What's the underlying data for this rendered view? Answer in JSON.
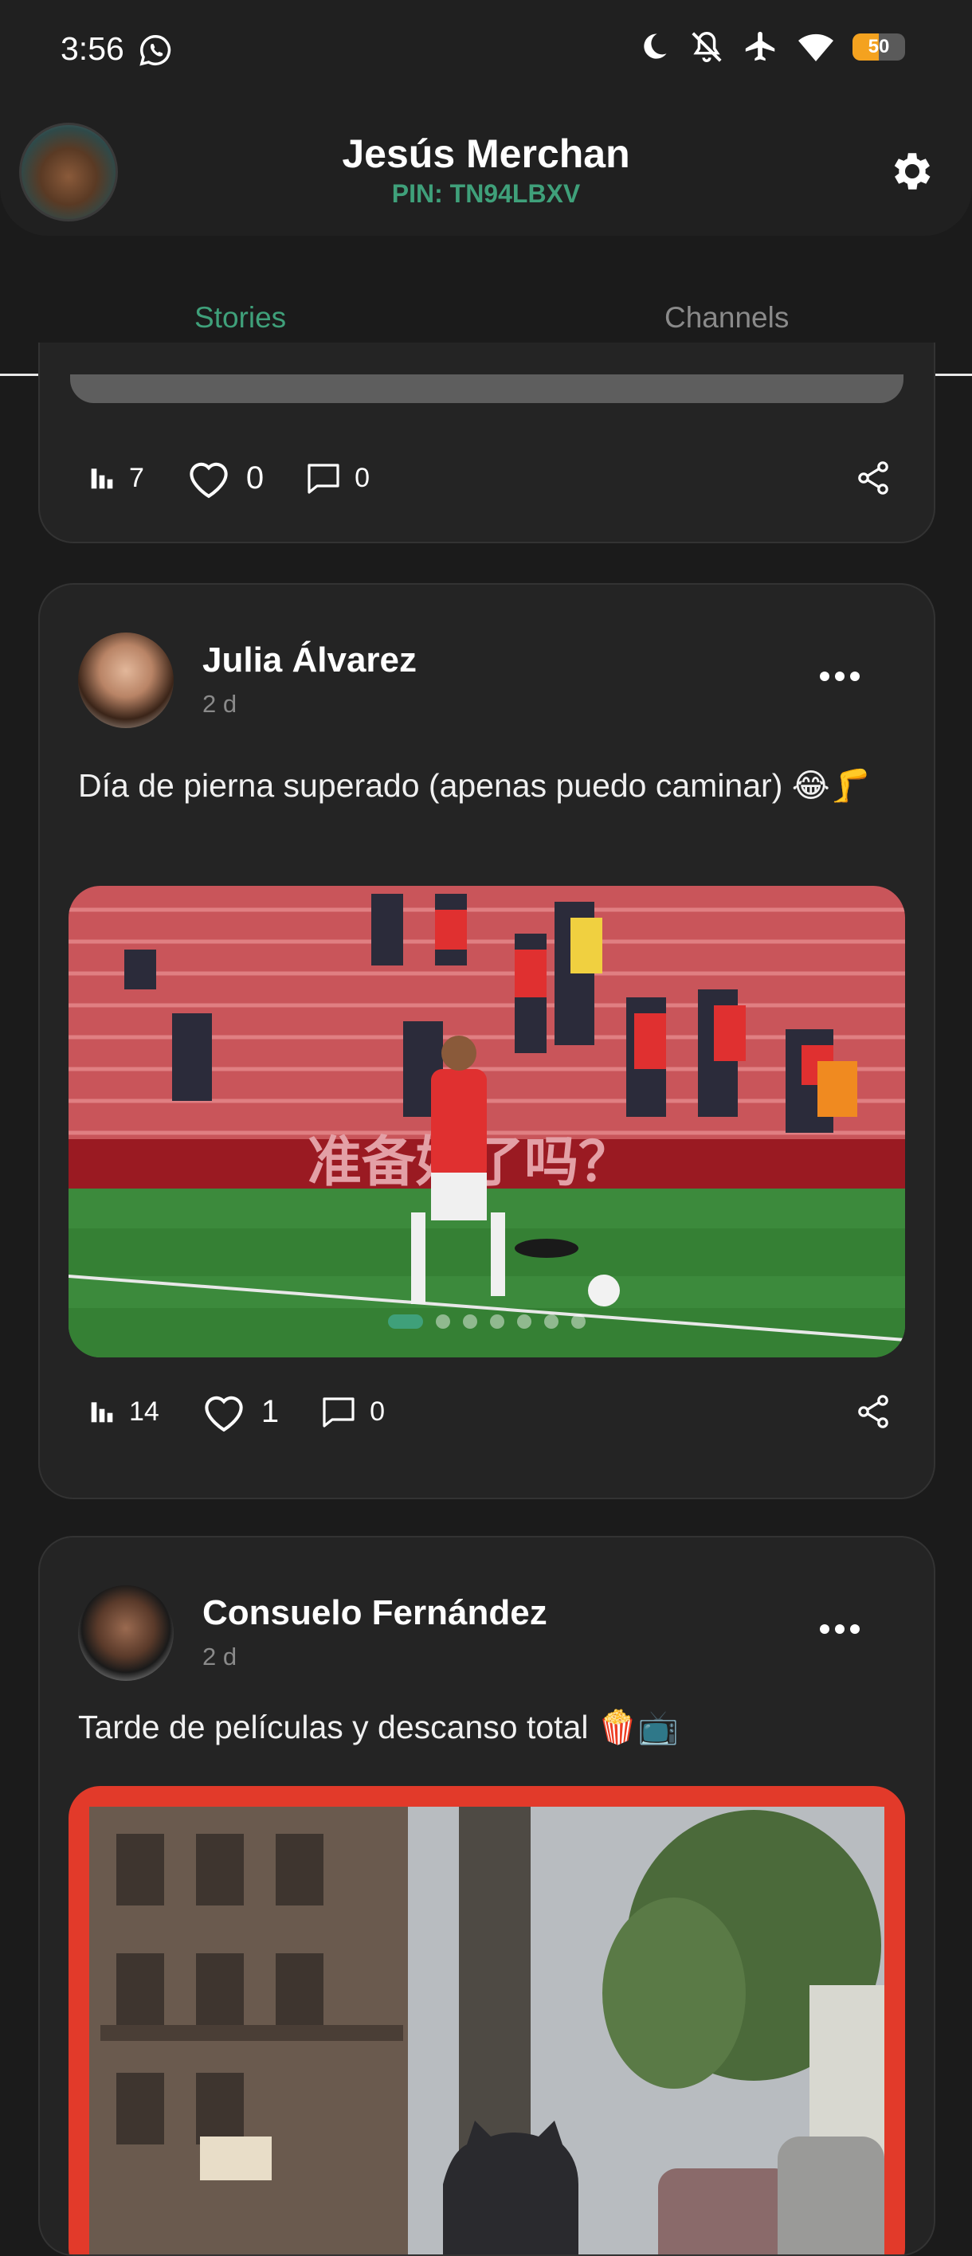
{
  "status_bar": {
    "time": "3:56",
    "battery_level": "50",
    "icons": [
      "whatsapp-icon",
      "moon-icon",
      "bell-off-icon",
      "airplane-icon",
      "wifi-icon",
      "battery-icon"
    ]
  },
  "header": {
    "name": "Jesús Merchan",
    "pin": "PIN: TN94LBXV"
  },
  "tabs": [
    {
      "label": "Stories",
      "selected": true
    },
    {
      "label": "Channels",
      "selected": false
    }
  ],
  "colors": {
    "accent": "#3fa07a",
    "background": "#1b1b1b",
    "card": "#242424",
    "battery": "#f4a21f"
  },
  "posts": [
    {
      "views": "7",
      "likes": "0",
      "comments": "0"
    },
    {
      "author": "Julia Álvarez",
      "time": "2 d",
      "text": "Día de pierna superado (apenas puedo caminar) 😂🦵",
      "image_count": 7,
      "image_current": 1,
      "views": "14",
      "likes": "1",
      "comments": "0",
      "photo_banner_text": "准备好了吗？"
    },
    {
      "author": "Consuelo Fernández",
      "time": "2 d",
      "text": "Tarde de películas y descanso total 🍿📺"
    }
  ]
}
